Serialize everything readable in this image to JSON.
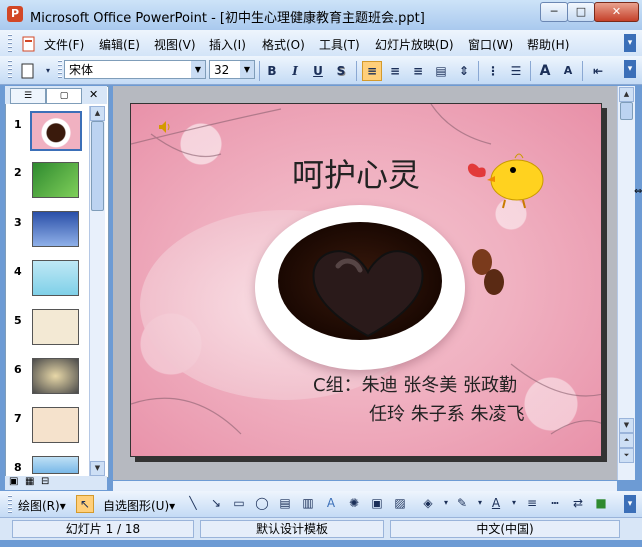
{
  "window": {
    "title": "Microsoft Office PowerPoint - [初中生心理健康教育主题班会.ppt]",
    "app_icon_letter": "P"
  },
  "window_controls": {
    "minimize": "─",
    "maximize": "□",
    "close": "✕"
  },
  "menu": [
    "文件(F)",
    "编辑(E)",
    "视图(V)",
    "插入(I)",
    "格式(O)",
    "工具(T)",
    "幻灯片放映(D)",
    "窗口(W)",
    "帮助(H)"
  ],
  "toolbar": {
    "font_name": "宋体",
    "font_size": "32",
    "bold": "B",
    "italic": "I",
    "underline": "U",
    "shadow": "S",
    "icons": [
      "new-icon",
      "align-left-icon",
      "align-center-icon",
      "align-right-icon",
      "distribute-icon",
      "line-spacing-icon",
      "numbering-icon",
      "bullets-icon",
      "grow-font-icon",
      "shrink-font-icon",
      "indent-icon"
    ],
    "grow_font": "A",
    "shrink_font": "A"
  },
  "left_pane": {
    "tab_outline": "☰",
    "tab_slides": "▢",
    "close": "✕",
    "slides": [
      {
        "num": "1",
        "color": "#f0b1c1"
      },
      {
        "num": "2",
        "color": "#3a9a3a"
      },
      {
        "num": "3",
        "color": "#2a4fa8"
      },
      {
        "num": "4",
        "color": "#7fd0e8"
      },
      {
        "num": "5",
        "color": "#e9d8b8"
      },
      {
        "num": "6",
        "color": "#6a6a6a"
      },
      {
        "num": "7",
        "color": "#f3dcc0"
      },
      {
        "num": "8",
        "color": "#79b8e8"
      }
    ],
    "selected": "1"
  },
  "slide": {
    "title": "呵护心灵",
    "names_line1": "C组：朱迪  张冬美  张政勤",
    "names_line2": "任玲  朱子系  朱凌飞"
  },
  "drawbar": {
    "draw": "绘图(R)▾",
    "autoshapes": "自选图形(U)▾"
  },
  "status": {
    "slide_info": "幻灯片 1 / 18",
    "template": "默认设计模板",
    "language": "中文(中国)"
  }
}
